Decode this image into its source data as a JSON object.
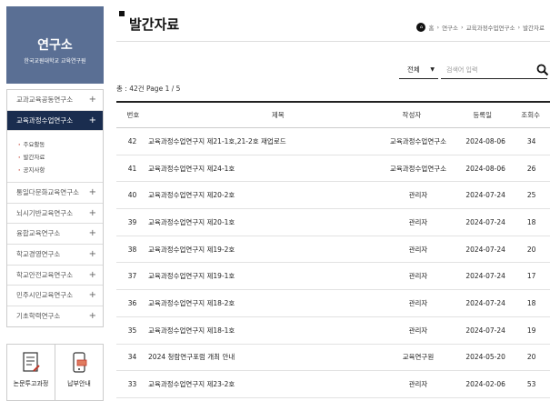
{
  "brand": {
    "title": "연구소",
    "subtitle": "한국교원대학교 교육연구원"
  },
  "sidebar": {
    "items": [
      {
        "label": "교과교육공동연구소",
        "active": false
      },
      {
        "label": "교육과정수업연구소",
        "active": true
      },
      {
        "label": "통일다문화교육연구소",
        "active": false
      },
      {
        "label": "뇌시기반교육연구소",
        "active": false
      },
      {
        "label": "융합교육연구소",
        "active": false
      },
      {
        "label": "학교경영연구소",
        "active": false
      },
      {
        "label": "학교안전교육연구소",
        "active": false
      },
      {
        "label": "민주시민교육연구소",
        "active": false
      },
      {
        "label": "기초학력연구소",
        "active": false
      }
    ],
    "submenu": [
      "주요활동",
      "발간자료",
      "공지사항"
    ]
  },
  "quick": {
    "left_label": "논문투고과정",
    "right_label": "납부안내"
  },
  "page": {
    "title": "발간자료"
  },
  "breadcrumb": [
    "홈",
    "연구소",
    "교육과정수업연구소",
    "발간자료"
  ],
  "search": {
    "select_value": "전체",
    "placeholder": "검색어 입력"
  },
  "list_info": "총 : 42건 Page 1 / 5",
  "table": {
    "headers": {
      "num": "번호",
      "title": "제목",
      "author": "작성자",
      "date": "등록일",
      "views": "조회수"
    },
    "rows": [
      {
        "num": "42",
        "title": "교육과정수업연구지 제21-1호,21-2호 재업로드",
        "author": "교육과정수업연구소",
        "date": "2024-08-06",
        "views": "34"
      },
      {
        "num": "41",
        "title": "교육과정수업연구지 제24-1호",
        "author": "교육과정수업연구소",
        "date": "2024-08-06",
        "views": "26"
      },
      {
        "num": "40",
        "title": "교육과정수업연구지 제20-2호",
        "author": "관리자",
        "date": "2024-07-24",
        "views": "25"
      },
      {
        "num": "39",
        "title": "교육과정수업연구지 제20-1호",
        "author": "관리자",
        "date": "2024-07-24",
        "views": "18"
      },
      {
        "num": "38",
        "title": "교육과정수업연구지 제19-2호",
        "author": "관리자",
        "date": "2024-07-24",
        "views": "20"
      },
      {
        "num": "37",
        "title": "교육과정수업연구지 제19-1호",
        "author": "관리자",
        "date": "2024-07-24",
        "views": "17"
      },
      {
        "num": "36",
        "title": "교육과정수업연구지 제18-2호",
        "author": "관리자",
        "date": "2024-07-24",
        "views": "18"
      },
      {
        "num": "35",
        "title": "교육과정수업연구지 제18-1호",
        "author": "관리자",
        "date": "2024-07-24",
        "views": "19"
      },
      {
        "num": "34",
        "title": "2024 청람연구포럼 개최 안내",
        "author": "교육연구원",
        "date": "2024-05-20",
        "views": "20"
      },
      {
        "num": "33",
        "title": "교육과정수업연구지 제23-2호",
        "author": "관리자",
        "date": "2024-02-06",
        "views": "53"
      }
    ]
  },
  "colors": {
    "brand_bg": "#5a6f94",
    "active_menu": "#1a2d4f",
    "accent_dot": "#c0392b"
  },
  "icons": {
    "home": "home-icon",
    "search": "search-icon",
    "plus": "plus-icon"
  }
}
